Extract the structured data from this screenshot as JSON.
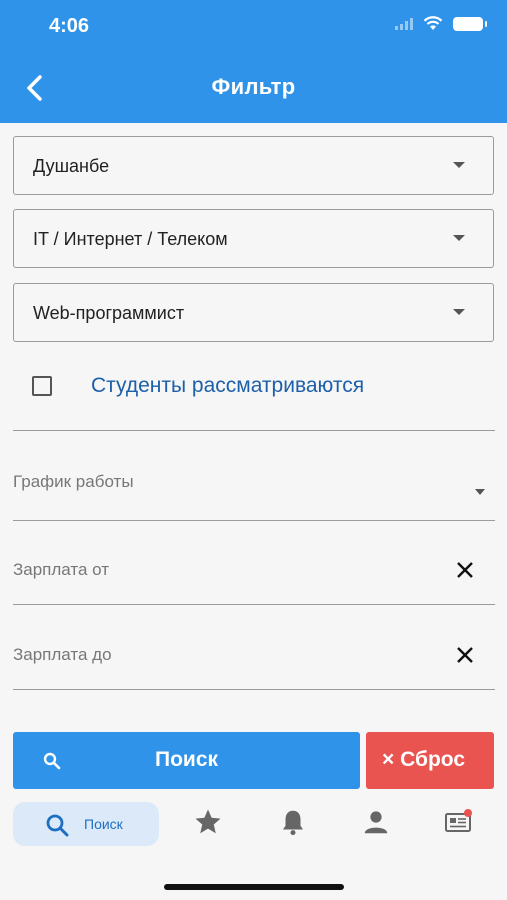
{
  "status_bar": {
    "time": "4:06"
  },
  "header": {
    "title": "Фильтр"
  },
  "filters": {
    "city": "Душанбе",
    "industry": "IT / Интернет / Телеком",
    "position": "Web-программист",
    "students_label": "Студенты рассматриваются",
    "students_checked": false,
    "schedule_label": "График работы",
    "salary_from_label": "Зарплата от",
    "salary_to_label": "Зарплата до"
  },
  "actions": {
    "search_label": "Поиск",
    "reset_label": "× Сброс"
  },
  "bottom_nav": {
    "active": "search",
    "search_label": "Поиск",
    "items": [
      "search-icon",
      "star-icon",
      "bell-icon",
      "person-icon",
      "news-icon"
    ]
  },
  "colors": {
    "primary": "#2f93ea",
    "reset": "#e95451",
    "link_text": "#1d5fa8",
    "nav_active_bg": "#dbe9f9",
    "badge": "#e95451"
  }
}
